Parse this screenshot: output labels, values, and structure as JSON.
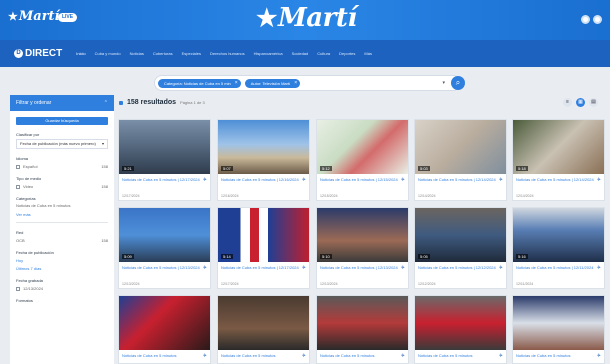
{
  "header": {
    "logo_small": "Martí",
    "live_badge": "LIVE",
    "logo_main": "Martí"
  },
  "navbar": {
    "direct": "DIRECT",
    "items": [
      "Inicio",
      "Cuba y mundo",
      "Noticias",
      "Coberturas",
      "Especiales",
      "Derechos humanos",
      "Hispanoamérica",
      "Sociedad",
      "Cultura",
      "Deportes",
      "Más"
    ]
  },
  "search": {
    "chips": [
      "Categoría: Noticias de Cuba en 5 min",
      "Autor: Televisión Martí"
    ]
  },
  "results": {
    "count": "158 resultados",
    "page": "Página 1 de 3"
  },
  "sidebar": {
    "header": "Filtrar y ordenar",
    "save_button": "Guardar búsqueda",
    "sort_label": "Clasificar por",
    "sort_value": "Fecha de publicación (más nuevo primero)",
    "source_label": "Idioma",
    "source_item": "Español",
    "source_count": "158",
    "media_label": "Tipo de medio",
    "media_item": "Video",
    "media_count": "158",
    "categories_label": "Categorías",
    "categories_text": "Noticias de Cuba en 5 minutos",
    "categories_link": "Ver más",
    "red_label": "Red",
    "red_item": "OCB",
    "red_count": "158",
    "pubdate_label": "Fecha de publicación",
    "pubdate_link1": "Hoy",
    "pubdate_link2": "Últimos 7 días",
    "recorded_label": "Fecha grabada",
    "recorded_item": "12/13/2024",
    "formats_label": "Formatos"
  },
  "cards": [
    {
      "title": "Noticias de Cuba en 5 minutos | 12/17/2024",
      "date": "12/17/2024",
      "duration": "5:21"
    },
    {
      "title": "Noticias de Cuba en 5 minutos | 12/16/2024",
      "date": "12/16/2024",
      "duration": "5:07"
    },
    {
      "title": "Noticias de Cuba en 5 minutos | 12/15/2024",
      "date": "12/15/2024",
      "duration": "5:12"
    },
    {
      "title": "Noticias de Cuba en 5 minutos | 12/14/2024",
      "date": "12/14/2024",
      "duration": "5:03"
    },
    {
      "title": "Noticias de Cuba en 5 minutos | 12/14/2024",
      "date": "12/14/2024",
      "duration": "5:18"
    },
    {
      "title": "Noticias de Cuba en 5 minutos | 12/13/2024",
      "date": "12/13/2024",
      "duration": "5:09"
    },
    {
      "title": "Noticias de Cuba en 5 minutos | 12/17/2024",
      "date": "12/17/2024",
      "duration": "5:14"
    },
    {
      "title": "Noticias de Cuba en 5 minutos | 12/13/2024",
      "date": "12/13/2024",
      "duration": "5:10"
    },
    {
      "title": "Noticias de Cuba en 5 minutos | 12/12/2024",
      "date": "12/12/2024",
      "duration": "5:05"
    },
    {
      "title": "Noticias de Cuba en 5 minutos | 12/11/2024",
      "date": "12/11/2024",
      "duration": "5:16"
    },
    {
      "title": "Noticias de Cuba en 5 minutos",
      "date": "",
      "duration": ""
    },
    {
      "title": "Noticias de Cuba en 5 minutos",
      "date": "",
      "duration": ""
    },
    {
      "title": "Noticias de Cuba en 5 minutos",
      "date": "",
      "duration": ""
    },
    {
      "title": "Noticias de Cuba en 5 minutos",
      "date": "",
      "duration": ""
    },
    {
      "title": "Noticias de Cuba en 5 minutos",
      "date": "",
      "duration": ""
    }
  ]
}
